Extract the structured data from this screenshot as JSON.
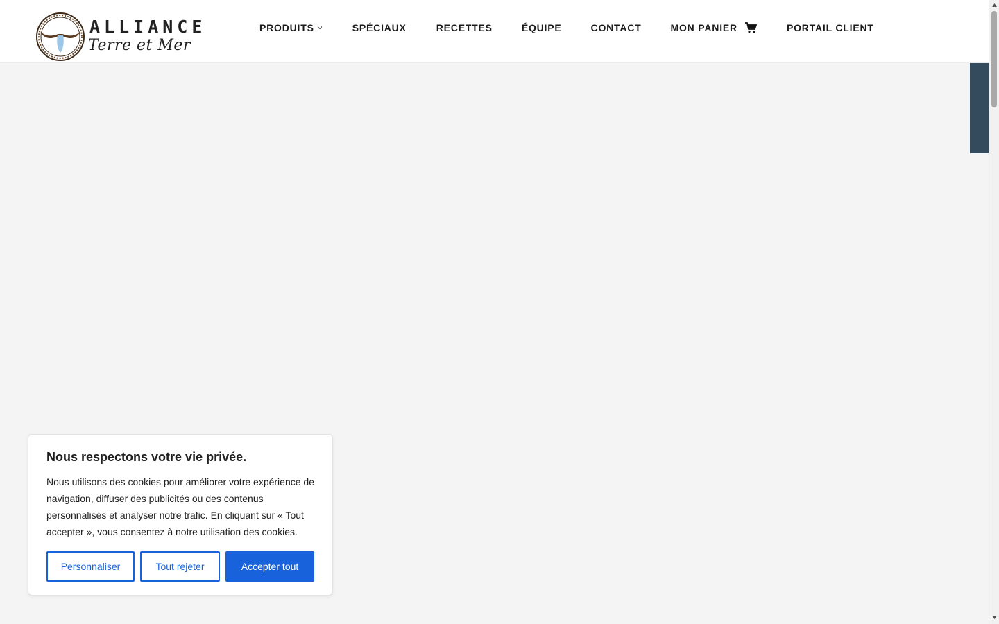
{
  "brand": {
    "name": "ALLIANCE",
    "tagline": "Terre et Mer"
  },
  "nav": {
    "items": [
      {
        "label": "PRODUITS",
        "has_dropdown": true
      },
      {
        "label": "SPÉCIAUX"
      },
      {
        "label": "RECETTES"
      },
      {
        "label": "ÉQUIPE"
      },
      {
        "label": "CONTACT"
      },
      {
        "label": "MON PANIER",
        "icon": "cart-icon"
      },
      {
        "label": "PORTAIL CLIENT"
      }
    ]
  },
  "cookie_banner": {
    "title": "Nous respectons votre vie privée.",
    "text": "Nous utilisons des cookies pour améliorer votre expérience de navigation, diffuser des publicités ou des contenus personnalisés et analyser notre trafic. En cliquant sur « Tout accepter », vous consentez à notre utilisation des cookies.",
    "buttons": {
      "customize": "Personnaliser",
      "reject": "Tout rejeter",
      "accept": "Accepter tout"
    }
  },
  "colors": {
    "accent": "#1863dc",
    "side_tab": "#344b5e",
    "background": "#f4f4f4"
  }
}
